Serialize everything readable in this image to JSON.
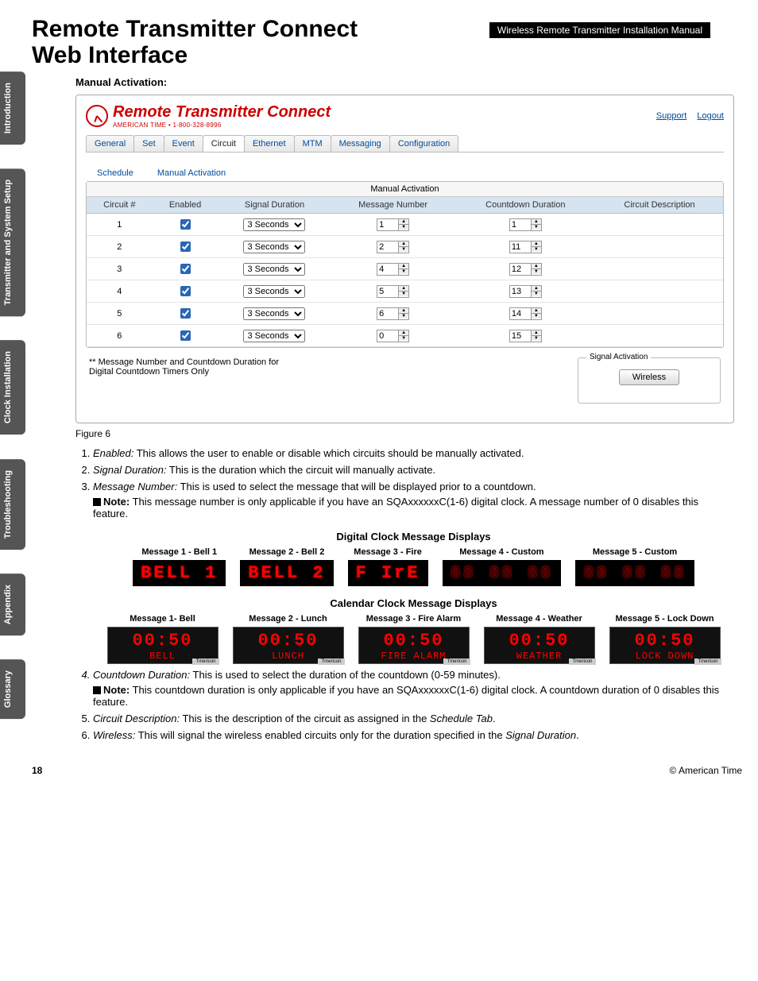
{
  "page": {
    "title": "Remote Transmitter Connect Web Interface",
    "manual_tag": "Wireless Remote Transmitter Installation Manual",
    "section_label": "Manual Activation:",
    "figure_caption": "Figure 6",
    "page_number": "18",
    "copyright": "© American Time"
  },
  "side_tabs": [
    "Introduction",
    "Transmitter and\nSystem Setup",
    "Clock\nInstallation",
    "Troubleshooting",
    "Appendix",
    "Glossary"
  ],
  "app": {
    "brand_title": "Remote Transmitter Connect",
    "brand_sub": "AMERICAN TIME • 1-800-328-8996",
    "header_links": [
      "Support",
      "Logout"
    ],
    "tabs": [
      "General",
      "Set",
      "Event",
      "Circuit",
      "Ethernet",
      "MTM",
      "Messaging",
      "Configuration"
    ],
    "active_tab": "Circuit",
    "subtabs": [
      "Schedule",
      "Manual Activation"
    ],
    "table": {
      "title": "Manual Activation",
      "headers": [
        "Circuit #",
        "Enabled",
        "Signal Duration",
        "Message Number",
        "Countdown Duration",
        "Circuit Description"
      ],
      "rows": [
        {
          "circuit": "1",
          "enabled": true,
          "duration": "3 Seconds",
          "msg": "1",
          "countdown": "1",
          "desc": ""
        },
        {
          "circuit": "2",
          "enabled": true,
          "duration": "3 Seconds",
          "msg": "2",
          "countdown": "11",
          "desc": ""
        },
        {
          "circuit": "3",
          "enabled": true,
          "duration": "3 Seconds",
          "msg": "4",
          "countdown": "12",
          "desc": ""
        },
        {
          "circuit": "4",
          "enabled": true,
          "duration": "3 Seconds",
          "msg": "5",
          "countdown": "13",
          "desc": ""
        },
        {
          "circuit": "5",
          "enabled": true,
          "duration": "3 Seconds",
          "msg": "6",
          "countdown": "14",
          "desc": ""
        },
        {
          "circuit": "6",
          "enabled": true,
          "duration": "3 Seconds",
          "msg": "0",
          "countdown": "15",
          "desc": ""
        }
      ],
      "footnote": "** Message Number and Countdown Duration for Digital Countdown Timers Only"
    },
    "signal_box": {
      "legend": "Signal Activation",
      "button": "Wireless"
    }
  },
  "list": {
    "i1": {
      "term": "Enabled:",
      "text": " This allows the user to enable or disable which circuits should be manually activated."
    },
    "i2": {
      "term": "Signal Duration:",
      "text": " This is the duration which the circuit will manually activate."
    },
    "i3": {
      "term": "Message Number:",
      "text": " This is used to select the message that will be displayed prior to a countdown.",
      "note_label": "Note:",
      "note_text": " This message number is only applicable if you have an SQAxxxxxxC(1-6) digital clock. A message number of 0 disables this feature."
    },
    "i4": {
      "term": "Countdown Duration:",
      "text": " This is used to select the duration of the countdown (0-59 minutes).",
      "note_label": "Note:",
      "note_text": " This countdown duration is only applicable if you have an SQAxxxxxxC(1-6) digital clock. A countdown duration of 0 disables this feature."
    },
    "i5": {
      "term": "Circuit Description:",
      "text": " This is the description of the circuit as assigned in the ",
      "term2": "Schedule Tab",
      "text2": "."
    },
    "i6": {
      "term": "Wireless:",
      "text": " This will signal the wireless enabled circuits only for the duration specified in the ",
      "term2": "Signal Duration",
      "text2": "."
    }
  },
  "displays": {
    "digital_title": "Digital Clock Message Displays",
    "digital": [
      {
        "label": "Message 1 - Bell 1",
        "seg": "BELL  1"
      },
      {
        "label": "Message 2 - Bell 2",
        "seg": "BELL  2"
      },
      {
        "label": "Message 3 - Fire",
        "seg": "F IrE "
      },
      {
        "label": "Message 4 - Custom",
        "seg": "88 88 88",
        "dim": true
      },
      {
        "label": "Message 5 - Custom",
        "seg": "88 88 88",
        "dim": true
      }
    ],
    "calendar_title": "Calendar Clock Message Displays",
    "calendar": [
      {
        "label": "Message 1- Bell",
        "time": "00:50",
        "word": "BELL"
      },
      {
        "label": "Message 2 - Lunch",
        "time": "00:50",
        "word": "LUNCH"
      },
      {
        "label": "Message 3 - Fire Alarm",
        "time": "00:50",
        "word": "FIRE ALARM"
      },
      {
        "label": "Message 4 - Weather",
        "time": "00:50",
        "word": "WEATHER"
      },
      {
        "label": "Message 5 - Lock Down",
        "time": "00:50",
        "word": "LOCK DOWN"
      }
    ]
  }
}
